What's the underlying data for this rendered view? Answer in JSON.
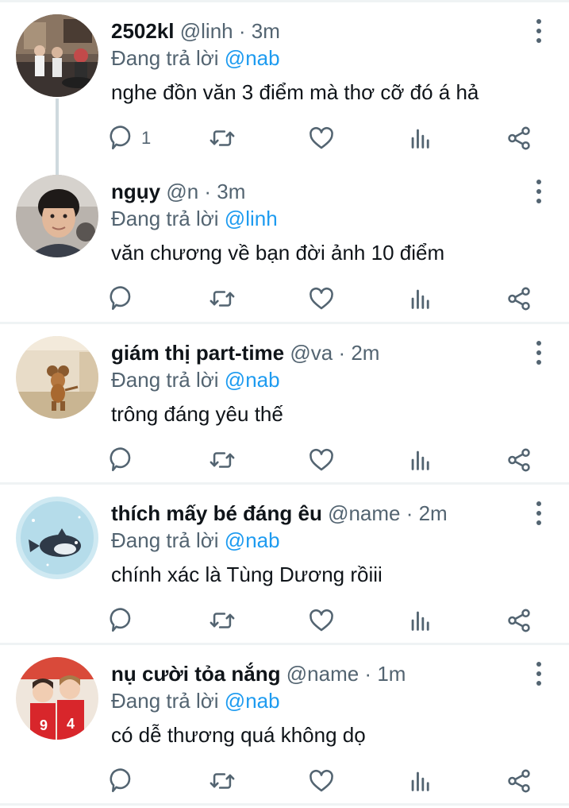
{
  "colors": {
    "link": "#1d9bf0",
    "secondary_text": "#536471",
    "primary_text": "#0f1419",
    "divider": "#eff3f4",
    "thread_line": "#cfd9de"
  },
  "icons": [
    "reply-icon",
    "retweet-icon",
    "like-icon",
    "analytics-icon",
    "share-icon",
    "more-icon"
  ],
  "replying_to_prefix": "Đang trả lời",
  "tweets": [
    {
      "display_name": "2502kl",
      "meta": "@linh · 3m",
      "replying_to": "@nab",
      "text": "nghe đồn văn 3 điểm mà thơ cỡ đó á hả",
      "reply_count": "1"
    },
    {
      "display_name": "ngụy",
      "meta": "@n · 3m",
      "replying_to": "@linh",
      "text": "văn chương về bạn đời ảnh 10 điểm",
      "reply_count": ""
    },
    {
      "display_name": "giám thị part-time",
      "meta": "@va · 2m",
      "replying_to": "@nab",
      "text": "trông đáng yêu thế",
      "reply_count": ""
    },
    {
      "display_name": "thích mấy bé đáng êu",
      "meta": "@name · 2m",
      "replying_to": "@nab",
      "text": "chính xác là Tùng Dương rồiii",
      "reply_count": ""
    },
    {
      "display_name": "nụ cười tỏa nắng",
      "meta": "@name · 1m",
      "replying_to": "@nab",
      "text": "có dễ thương quá không dọ",
      "reply_count": ""
    }
  ]
}
